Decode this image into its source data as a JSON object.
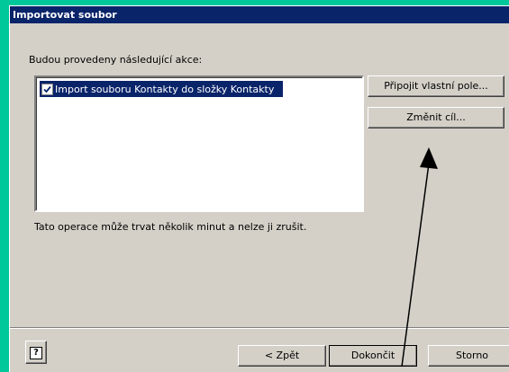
{
  "window": {
    "title": "Importovat soubor"
  },
  "main": {
    "prompt": "Budou provedeny následující akce:",
    "actions": [
      {
        "label": "Import souboru Kontakty do složky Kontakty",
        "checked": true,
        "selected": true
      }
    ],
    "note": "Tato operace může trvat několik minut a nelze ji zrušit."
  },
  "side_buttons": {
    "map_fields": "Připojit vlastní pole...",
    "change_destination": "Změnit cíl..."
  },
  "footer": {
    "help_icon": "?",
    "back": "< Zpět",
    "finish": "Dokončit",
    "cancel": "Storno"
  },
  "colors": {
    "desktop": "#00c89a",
    "titlebar": "#0a246a",
    "dialog": "#d4d0c8",
    "selection": "#0a246a"
  }
}
